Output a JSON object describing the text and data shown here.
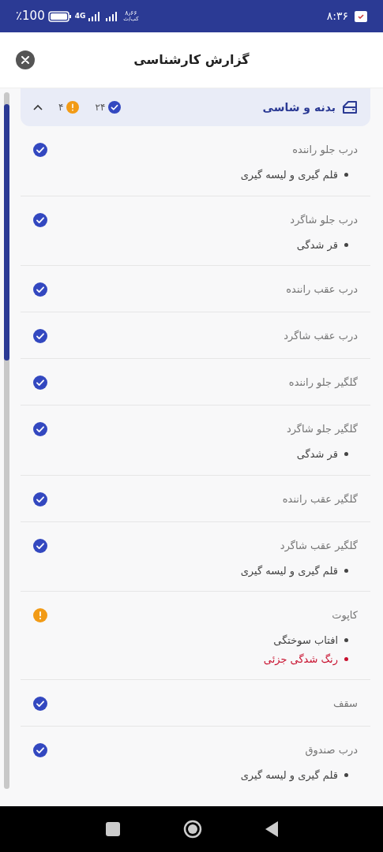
{
  "status_bar": {
    "time": "۸:۳۶",
    "net_speed": "۸٫۶۶",
    "net_unit": "کب/ث",
    "network": "4G",
    "battery": "٪100"
  },
  "header": {
    "title": "گزارش کارشناسی"
  },
  "section": {
    "title": "بدنه و شاسی",
    "ok_count": "۲۴",
    "warning_count": "۴",
    "expanded": true,
    "items": [
      {
        "name": "درب جلو راننده",
        "kind": "ok",
        "notes": [
          {
            "text": "قلم گیری و لیسه گیری",
            "color": "#444444"
          }
        ]
      },
      {
        "name": "درب جلو شاگرد",
        "kind": "ok",
        "notes": [
          {
            "text": "قر شدگی",
            "color": "#444444"
          }
        ]
      },
      {
        "name": "درب عقب راننده",
        "kind": "ok"
      },
      {
        "name": "درب عقب شاگرد",
        "kind": "ok"
      },
      {
        "name": "گلگیر جلو راننده",
        "kind": "ok"
      },
      {
        "name": "گلگیر جلو شاگرد",
        "kind": "ok",
        "notes": [
          {
            "text": "قر شدگی",
            "color": "#444444"
          }
        ]
      },
      {
        "name": "گلگیر عقب راننده",
        "kind": "ok"
      },
      {
        "name": "گلگیر عقب شاگرد",
        "kind": "ok",
        "notes": [
          {
            "text": "قلم گیری و لیسه گیری",
            "color": "#444444"
          }
        ]
      },
      {
        "name": "کاپوت",
        "kind": "warning",
        "notes": [
          {
            "text": "افتاب سوختگی",
            "color": "#444444"
          },
          {
            "text": "رنگ شدگی جزئی",
            "color": "#c8102e"
          }
        ]
      },
      {
        "name": "سقف",
        "kind": "ok"
      },
      {
        "name": "درب صندوق",
        "kind": "ok",
        "notes": [
          {
            "text": "قلم گیری و لیسه گیری",
            "color": "#444444"
          }
        ]
      }
    ]
  }
}
